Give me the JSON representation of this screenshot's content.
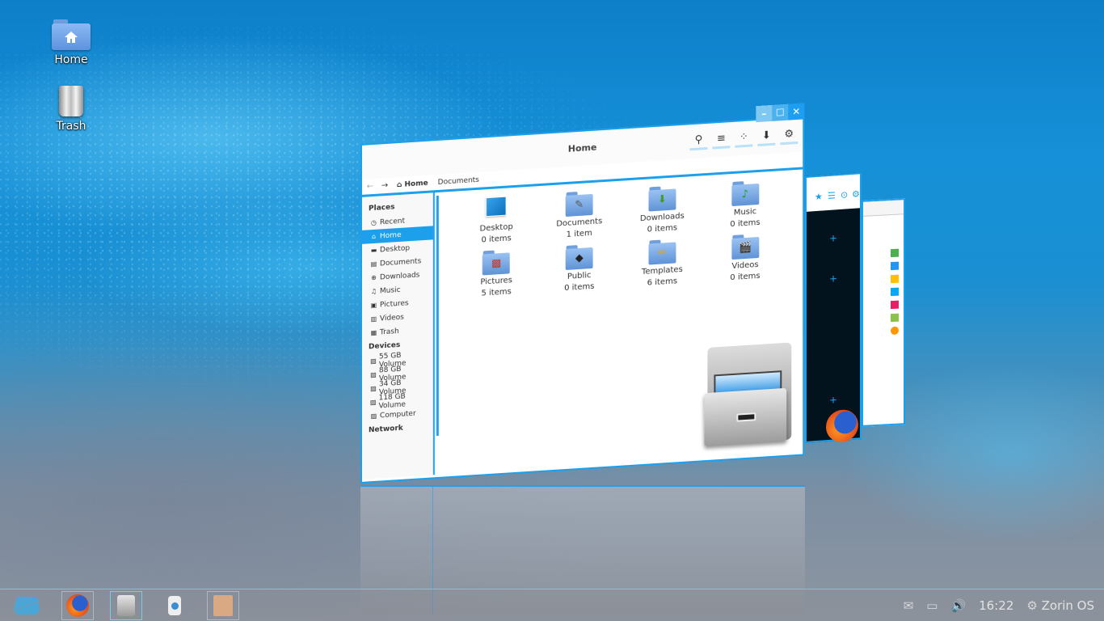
{
  "desktop": {
    "icons": [
      {
        "label": "Home",
        "icon": "home-folder-icon"
      },
      {
        "label": "Trash",
        "icon": "trash-icon"
      }
    ]
  },
  "file_manager": {
    "title": "Home",
    "window_buttons": {
      "minimize": "–",
      "maximize": "☐",
      "close": "✕"
    },
    "toolbar": [
      {
        "name": "search",
        "glyph": "⚲"
      },
      {
        "name": "list-view",
        "glyph": "≡"
      },
      {
        "name": "grid-view",
        "glyph": "⁘"
      },
      {
        "name": "download",
        "glyph": "⬇"
      },
      {
        "name": "settings",
        "glyph": "⚙"
      }
    ],
    "pathbar": {
      "back": "←",
      "forward": "→",
      "crumbs": [
        {
          "label": "Home",
          "icon": "⌂"
        },
        {
          "label": "Documents"
        }
      ]
    },
    "sidebar": {
      "places_heading": "Places",
      "places": [
        {
          "label": "Recent",
          "glyph": "◷"
        },
        {
          "label": "Home",
          "glyph": "⌂",
          "active": true
        },
        {
          "label": "Desktop",
          "glyph": "▬"
        },
        {
          "label": "Documents",
          "glyph": "▤"
        },
        {
          "label": "Downloads",
          "glyph": "⊕"
        },
        {
          "label": "Music",
          "glyph": "♫"
        },
        {
          "label": "Pictures",
          "glyph": "▣"
        },
        {
          "label": "Videos",
          "glyph": "▥"
        },
        {
          "label": "Trash",
          "glyph": "▦"
        }
      ],
      "devices_heading": "Devices",
      "devices": [
        {
          "label": "55 GB Volume",
          "glyph": "▨"
        },
        {
          "label": "88 GB Volume",
          "glyph": "▨"
        },
        {
          "label": "34 GB Volume",
          "glyph": "▨"
        },
        {
          "label": "118 GB Volume",
          "glyph": "▨"
        },
        {
          "label": "Computer",
          "glyph": "▨"
        }
      ],
      "network_heading": "Network"
    },
    "items": [
      {
        "name": "Desktop",
        "count": "0 items",
        "glyph": ""
      },
      {
        "name": "Documents",
        "count": "1 item",
        "glyph": "✎"
      },
      {
        "name": "Downloads",
        "count": "0 items",
        "glyph": "⬇"
      },
      {
        "name": "Music",
        "count": "0 items",
        "glyph": "♪"
      },
      {
        "name": "Pictures",
        "count": "5 items",
        "glyph": "▩"
      },
      {
        "name": "Public",
        "count": "0 items",
        "glyph": "◆"
      },
      {
        "name": "Templates",
        "count": "6 items",
        "glyph": "✏"
      },
      {
        "name": "Videos",
        "count": "0 items",
        "glyph": "🎬"
      }
    ]
  },
  "colors": {
    "accent": "#1da0ec",
    "selected_bg": "#1da0ec"
  },
  "taskbar": {
    "apps": [
      {
        "name": "Firefox"
      },
      {
        "name": "Files"
      },
      {
        "name": "Audio"
      },
      {
        "name": "Office"
      }
    ],
    "tray": {
      "mail_glyph": "✉",
      "battery_glyph": "▭",
      "volume_glyph": "🔊",
      "time": "16:22",
      "settings_glyph": "⚙",
      "os_label": "Zorin OS"
    }
  }
}
